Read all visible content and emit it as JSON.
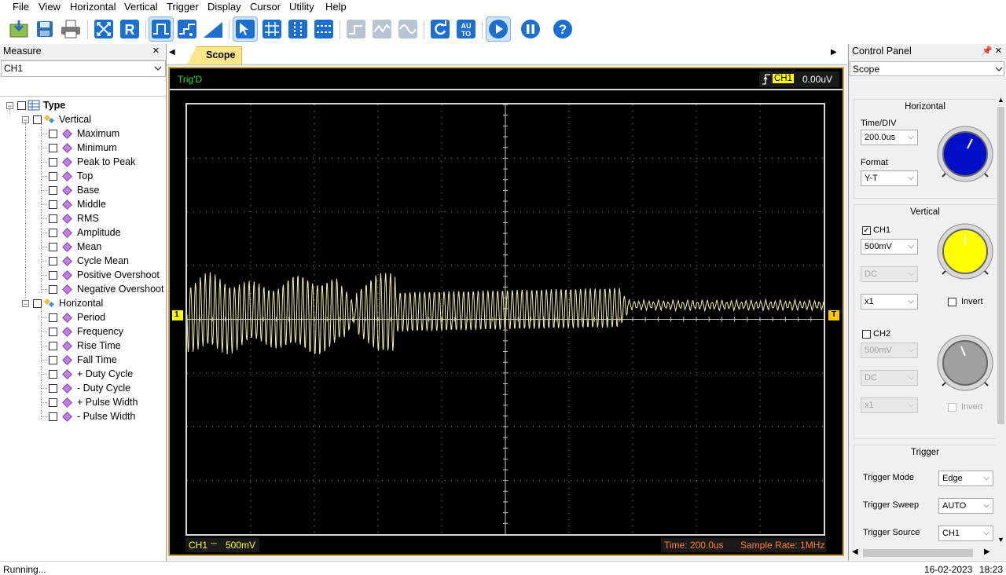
{
  "menu": [
    "File",
    "View",
    "Horizontal",
    "Vertical",
    "Trigger",
    "Display",
    "Cursor",
    "Utility",
    "Help"
  ],
  "toolbar_icons": [
    "open-icon",
    "save-icon",
    "print-icon",
    "autoscale-icon",
    "reset-icon",
    "pulse-icon",
    "step-icon",
    "ramp-icon",
    "select-cursor-icon",
    "grid-icon",
    "vertical-cursor-icon",
    "horizontal-cursor-icon",
    "step-wave-icon",
    "wave-icon",
    "sine-icon",
    "refresh-icon",
    "auto-icon",
    "run-icon",
    "pause-icon",
    "help-icon"
  ],
  "measure": {
    "title": "Measure",
    "close": "×",
    "channel": "CH1",
    "tree": {
      "root": "Type",
      "vertical_label": "Vertical",
      "vertical_items": [
        "Maximum",
        "Minimum",
        "Peak to Peak",
        "Top",
        "Base",
        "Middle",
        "RMS",
        "Amplitude",
        "Mean",
        "Cycle Mean",
        "Positive Overshoot",
        "Negative Overshoot"
      ],
      "horizontal_label": "Horizontal",
      "horizontal_items": [
        "Period",
        "Frequency",
        "Rise Time",
        "Fall Time",
        "+ Duty Cycle",
        "- Duty Cycle",
        "+ Pulse Width",
        "- Pulse Width"
      ]
    }
  },
  "scope": {
    "tab": "Scope",
    "trig_status": "Trig'D",
    "trigger_channel": "CH1",
    "trigger_level": "0.00uV",
    "ch1_marker": "1",
    "trigger_marker": "T",
    "ch1_coupling_label": "CH1",
    "ch1_scale": "500mV",
    "time_label": "Time: 200.0us",
    "sample_rate_label": "Sample Rate: 1MHz",
    "waveform_color": "#f5f0a0"
  },
  "control_panel": {
    "title": "Control Panel",
    "mode": "Scope",
    "horizontal": {
      "title": "Horizontal",
      "time_div_label": "Time/DIV",
      "time_div_value": "200.0us",
      "format_label": "Format",
      "format_value": "Y-T"
    },
    "vertical": {
      "title": "Vertical",
      "ch1_label": "CH1",
      "ch1_checked": true,
      "ch1_volt": "500mV",
      "ch1_coupling": "DC",
      "ch1_probe": "x1",
      "ch1_invert": "Invert",
      "ch2_label": "CH2",
      "ch2_checked": false,
      "ch2_volt": "500mV",
      "ch2_coupling": "DC",
      "ch2_probe": "x1",
      "ch2_invert": "Invert"
    },
    "trigger": {
      "title": "Trigger",
      "mode_label": "Trigger Mode",
      "mode_value": "Edge",
      "sweep_label": "Trigger Sweep",
      "sweep_value": "AUTO",
      "source_label": "Trigger Source",
      "source_value": "CH1"
    },
    "knob_colors": {
      "horizontal": "#0010c8",
      "ch1": "#ffff00",
      "ch2": "#a0a0a0"
    }
  },
  "status": {
    "left": "Running...",
    "date": "16-02-2023",
    "time": "18:23"
  }
}
